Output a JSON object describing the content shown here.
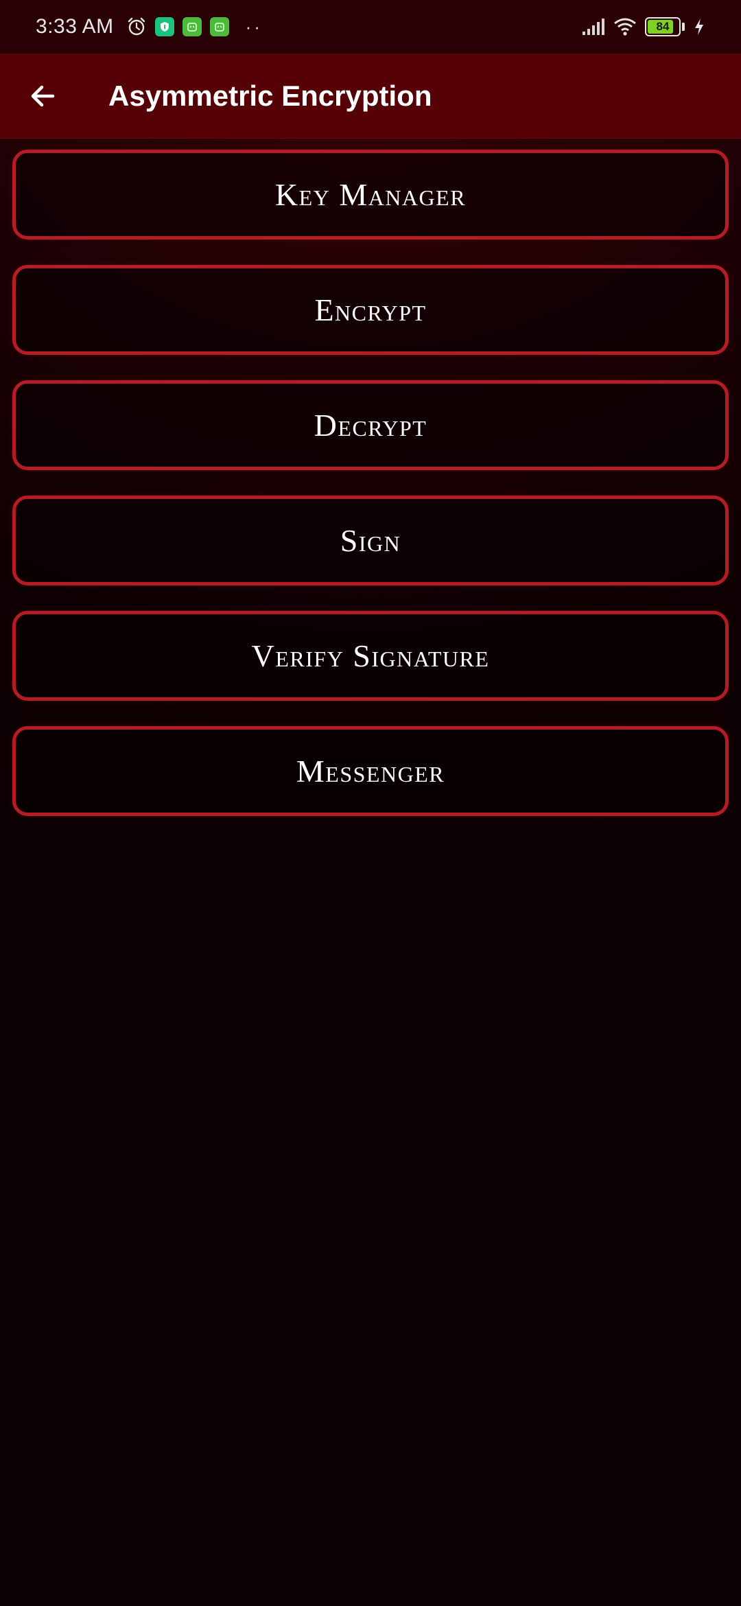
{
  "status_bar": {
    "time": "3:33 AM",
    "battery_level": "84",
    "battery_fraction": 0.84,
    "icons": [
      "alarm-icon",
      "shield-app-icon",
      "android-app-icon",
      "android-app-icon",
      "more-dots-icon",
      "signal-icon",
      "wifi-icon",
      "battery-icon",
      "charging-icon"
    ],
    "dots": "··",
    "app_badge_colors": [
      "#19c37d",
      "#4cbb3a",
      "#4cbb3a"
    ]
  },
  "app_bar": {
    "title": "Asymmetric Encryption",
    "back_icon": "arrow-left-icon",
    "background": "#560106"
  },
  "menu": {
    "accent_border": "#b71c24",
    "items": [
      {
        "label": "Key Manager"
      },
      {
        "label": "Encrypt"
      },
      {
        "label": "Decrypt"
      },
      {
        "label": "Sign"
      },
      {
        "label": "Verify Signature"
      },
      {
        "label": "Messenger"
      }
    ]
  }
}
